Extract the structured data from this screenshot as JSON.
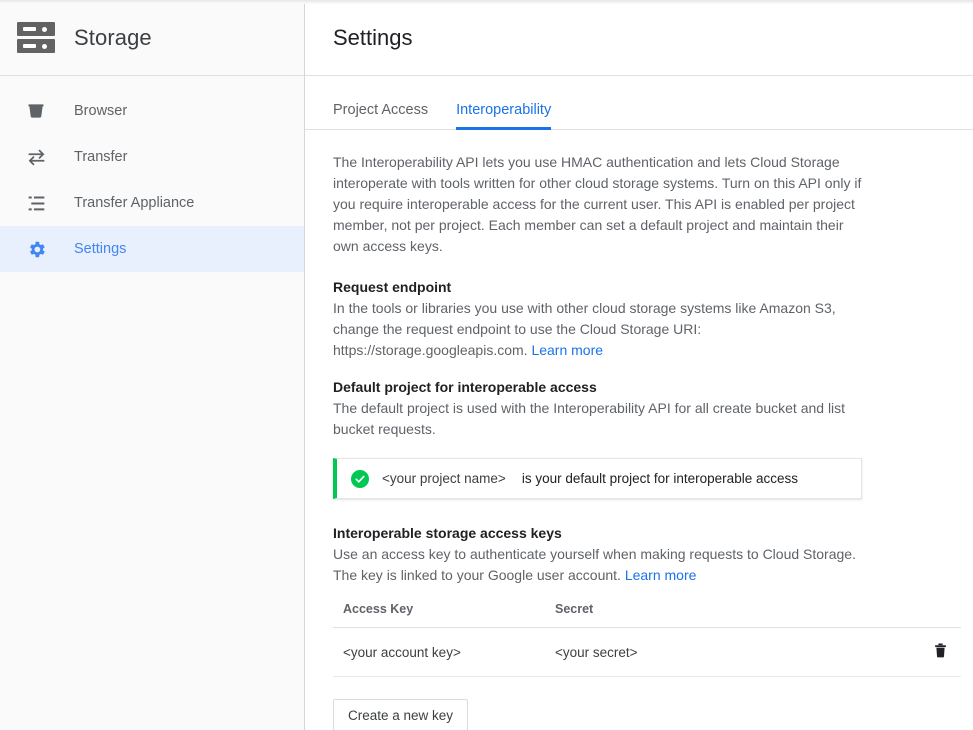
{
  "sidebar": {
    "product": {
      "name": "Storage",
      "icon": "storage-rack-icon"
    },
    "items": [
      {
        "label": "Browser",
        "icon": "bucket-icon",
        "active": false
      },
      {
        "label": "Transfer",
        "icon": "transfer-arrows-icon",
        "active": false
      },
      {
        "label": "Transfer Appliance",
        "icon": "list-lines-icon",
        "active": false
      },
      {
        "label": "Settings",
        "icon": "gear-icon",
        "active": true
      }
    ]
  },
  "header": {
    "title": "Settings"
  },
  "tabs": [
    {
      "label": "Project Access",
      "active": false
    },
    {
      "label": "Interoperability",
      "active": true
    }
  ],
  "main": {
    "intro": "The Interoperability API lets you use HMAC authentication and lets Cloud Storage interoperate with tools written for other cloud storage systems. Turn on this API only if you require interoperable access for the current user. This API is enabled per project member, not per project. Each member can set a default project and maintain their own access keys.",
    "request_endpoint": {
      "title": "Request endpoint",
      "body": "In the tools or libraries you use with other cloud storage systems like Amazon S3, change the request endpoint to use the Cloud Storage URI: https://storage.googleapis.com.",
      "learn_more": "Learn more"
    },
    "default_project": {
      "title": "Default project for interoperable access",
      "body": "The default project is used with the Interoperability API for all create bucket and list bucket requests.",
      "card": {
        "status_icon": "check-circle-icon",
        "project_name": "<your project name>",
        "message": "is your default project for interoperable access"
      }
    },
    "access_keys": {
      "title": "Interoperable storage access keys",
      "body": "Use an access key to authenticate yourself when making requests to Cloud Storage. The key is linked to your Google user account.",
      "learn_more": "Learn more",
      "table": {
        "columns": [
          "Access Key",
          "Secret",
          ""
        ],
        "rows": [
          {
            "access_key": "<your account key>",
            "secret": "<your secret>",
            "delete_icon": "trash-icon"
          }
        ]
      },
      "create_button": "Create a new key"
    }
  },
  "colors": {
    "accent_blue": "#1a73e8",
    "nav_active_blue": "#4285f4",
    "nav_active_bg": "#e8f0fe",
    "status_green": "#00c853",
    "sidebar_bg": "#fafafa",
    "text_primary": "#202124",
    "text_secondary": "#5f6368"
  }
}
